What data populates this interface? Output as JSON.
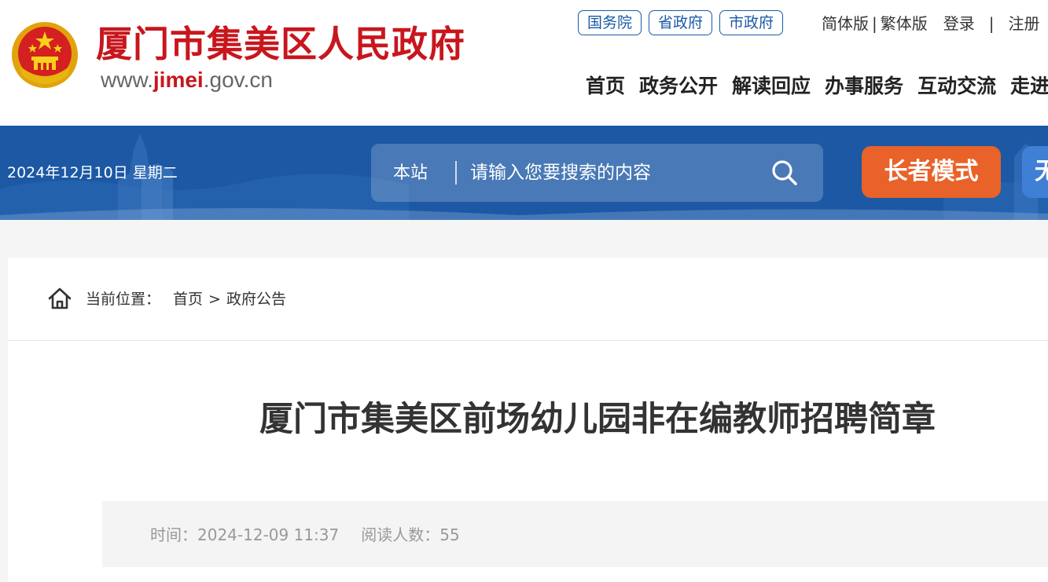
{
  "header": {
    "site_name": "厦门市集美区人民政府",
    "site_url_prefix": "www.",
    "site_url_accent": "jimei",
    "site_url_suffix": ".gov.cn",
    "gov_links": [
      "国务院",
      "省政府",
      "市政府"
    ],
    "util": {
      "simplified": "简体版",
      "separator": "|",
      "traditional": "繁体版",
      "login": "登录",
      "register": "注册"
    },
    "nav": [
      "首页",
      "政务公开",
      "解读回应",
      "办事服务",
      "互动交流",
      "走进集美"
    ]
  },
  "band": {
    "date": "2024年12月10日 星期二",
    "search_scope": "本站",
    "search_placeholder": "请输入您要搜索的内容",
    "elder_mode": "长者模式",
    "accessibility": "无障碍"
  },
  "breadcrumb": {
    "label": "当前位置：",
    "items": [
      "首页",
      "政府公告"
    ],
    "arrow": ">"
  },
  "article": {
    "title": "厦门市集美区前场幼儿园非在编教师招聘简章",
    "time_label": "时间：",
    "time_value": "2024-12-09 11:37",
    "reads_label": "阅读人数：",
    "reads_value": "55"
  },
  "colors": {
    "brand_red": "#c8161d",
    "band_blue": "#1d5ba8",
    "elder_orange": "#e8622a",
    "link_blue": "#1b5aa6"
  }
}
